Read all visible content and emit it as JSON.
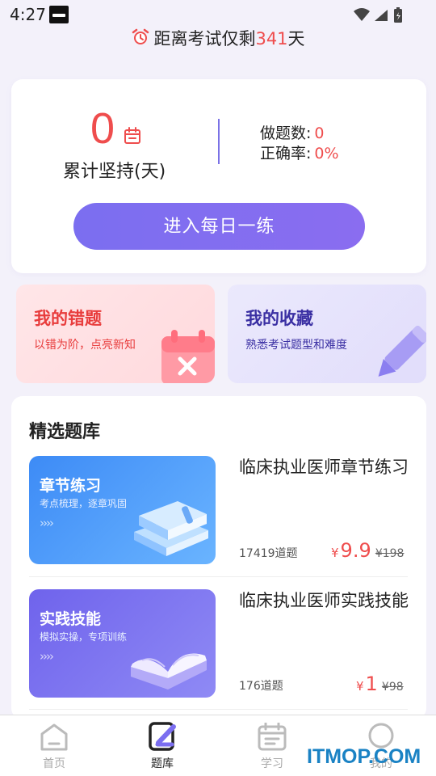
{
  "status": {
    "time": "4:27"
  },
  "countdown": {
    "prefix": "距离考试仅剩",
    "days": "341",
    "suffix": "天"
  },
  "stats": {
    "streak_value": "0",
    "streak_label": "累计坚持(天)",
    "done_label": "做题数:",
    "done_value": "0",
    "accuracy_label": "正确率:",
    "accuracy_value": "0%"
  },
  "daily_button": "进入每日一练",
  "wrong_card": {
    "title": "我的错题",
    "subtitle": "以错为阶，点亮新知"
  },
  "fav_card": {
    "title": "我的收藏",
    "subtitle": "熟悉考试题型和难度"
  },
  "section_title": "精选题库",
  "products": [
    {
      "banner_title": "章节练习",
      "banner_subtitle": "考点梳理，逐章巩固",
      "banner_chevrons": "››››",
      "title": "临床执业医师章节练习",
      "count": "17419道题",
      "currency": "¥",
      "price": "9.9",
      "original_price": "¥198"
    },
    {
      "banner_title": "实践技能",
      "banner_subtitle": "模拟实操，专项训练",
      "banner_chevrons": "››››",
      "title": "临床执业医师实践技能",
      "count": "176道题",
      "currency": "¥",
      "price": "1",
      "original_price": "¥98"
    }
  ],
  "tabs": [
    {
      "label": "首页",
      "icon": "home-icon"
    },
    {
      "label": "题库",
      "icon": "question-bank-icon"
    },
    {
      "label": "学习",
      "icon": "calendar-icon"
    },
    {
      "label": "我的",
      "icon": "profile-icon"
    }
  ],
  "watermark": "ITMOP.COM",
  "colors": {
    "accent": "#7b6ef0",
    "price": "#ef4d4d",
    "blue_banner": "#3d8bf6",
    "purple_banner": "#6f63ec"
  }
}
